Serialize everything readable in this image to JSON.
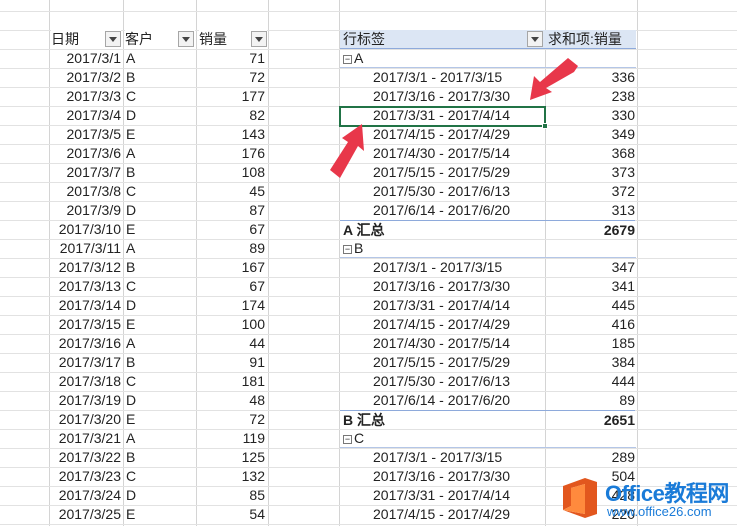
{
  "source": {
    "headers": {
      "date": "日期",
      "customer": "客户",
      "sales": "销量"
    },
    "rows": [
      {
        "date": "2017/3/1",
        "customer": "A",
        "sales": "71"
      },
      {
        "date": "2017/3/2",
        "customer": "B",
        "sales": "72"
      },
      {
        "date": "2017/3/3",
        "customer": "C",
        "sales": "177"
      },
      {
        "date": "2017/3/4",
        "customer": "D",
        "sales": "82"
      },
      {
        "date": "2017/3/5",
        "customer": "E",
        "sales": "143"
      },
      {
        "date": "2017/3/6",
        "customer": "A",
        "sales": "176"
      },
      {
        "date": "2017/3/7",
        "customer": "B",
        "sales": "108"
      },
      {
        "date": "2017/3/8",
        "customer": "C",
        "sales": "45"
      },
      {
        "date": "2017/3/9",
        "customer": "D",
        "sales": "87"
      },
      {
        "date": "2017/3/10",
        "customer": "E",
        "sales": "67"
      },
      {
        "date": "2017/3/11",
        "customer": "A",
        "sales": "89"
      },
      {
        "date": "2017/3/12",
        "customer": "B",
        "sales": "167"
      },
      {
        "date": "2017/3/13",
        "customer": "C",
        "sales": "67"
      },
      {
        "date": "2017/3/14",
        "customer": "D",
        "sales": "174"
      },
      {
        "date": "2017/3/15",
        "customer": "E",
        "sales": "100"
      },
      {
        "date": "2017/3/16",
        "customer": "A",
        "sales": "44"
      },
      {
        "date": "2017/3/17",
        "customer": "B",
        "sales": "91"
      },
      {
        "date": "2017/3/18",
        "customer": "C",
        "sales": "181"
      },
      {
        "date": "2017/3/19",
        "customer": "D",
        "sales": "48"
      },
      {
        "date": "2017/3/20",
        "customer": "E",
        "sales": "72"
      },
      {
        "date": "2017/3/21",
        "customer": "A",
        "sales": "119"
      },
      {
        "date": "2017/3/22",
        "customer": "B",
        "sales": "125"
      },
      {
        "date": "2017/3/23",
        "customer": "C",
        "sales": "132"
      },
      {
        "date": "2017/3/24",
        "customer": "D",
        "sales": "85"
      },
      {
        "date": "2017/3/25",
        "customer": "E",
        "sales": "54"
      }
    ]
  },
  "pivot": {
    "header_row_label": "行标签",
    "header_value_label": "求和项:销量",
    "rows": [
      {
        "kind": "group",
        "label": "A"
      },
      {
        "kind": "item",
        "label": "2017/3/1 - 2017/3/15",
        "value": "336"
      },
      {
        "kind": "item",
        "label": "2017/3/16 - 2017/3/30",
        "value": "238"
      },
      {
        "kind": "item",
        "label": "2017/3/31 - 2017/4/14",
        "value": "330"
      },
      {
        "kind": "item",
        "label": "2017/4/15 - 2017/4/29",
        "value": "349"
      },
      {
        "kind": "item",
        "label": "2017/4/30 - 2017/5/14",
        "value": "368"
      },
      {
        "kind": "item",
        "label": "2017/5/15 - 2017/5/29",
        "value": "373"
      },
      {
        "kind": "item",
        "label": "2017/5/30 - 2017/6/13",
        "value": "372"
      },
      {
        "kind": "item",
        "label": "2017/6/14 - 2017/6/20",
        "value": "313"
      },
      {
        "kind": "total",
        "label": "A 汇总",
        "value": "2679"
      },
      {
        "kind": "group",
        "label": "B"
      },
      {
        "kind": "item",
        "label": "2017/3/1 - 2017/3/15",
        "value": "347"
      },
      {
        "kind": "item",
        "label": "2017/3/16 - 2017/3/30",
        "value": "341"
      },
      {
        "kind": "item",
        "label": "2017/3/31 - 2017/4/14",
        "value": "445"
      },
      {
        "kind": "item",
        "label": "2017/4/15 - 2017/4/29",
        "value": "416"
      },
      {
        "kind": "item",
        "label": "2017/4/30 - 2017/5/14",
        "value": "185"
      },
      {
        "kind": "item",
        "label": "2017/5/15 - 2017/5/29",
        "value": "384"
      },
      {
        "kind": "item",
        "label": "2017/5/30 - 2017/6/13",
        "value": "444"
      },
      {
        "kind": "item",
        "label": "2017/6/14 - 2017/6/20",
        "value": "89"
      },
      {
        "kind": "total",
        "label": "B 汇总",
        "value": "2651"
      },
      {
        "kind": "group",
        "label": "C"
      },
      {
        "kind": "item",
        "label": "2017/3/1 - 2017/3/15",
        "value": "289"
      },
      {
        "kind": "item",
        "label": "2017/3/16 - 2017/3/30",
        "value": "504"
      },
      {
        "kind": "item",
        "label": "2017/3/31 - 2017/4/14",
        "value": "428"
      },
      {
        "kind": "item",
        "label": "2017/4/15 - 2017/4/29",
        "value": "220"
      }
    ],
    "expander_symbol": "−"
  },
  "watermark": {
    "title": "Office教程网",
    "url": "www.office26.com"
  },
  "colors": {
    "pivot_header_bg": "#dce6f4",
    "selection": "#217346",
    "arrow": "#e8374a",
    "watermark": "#1a7bd8"
  }
}
